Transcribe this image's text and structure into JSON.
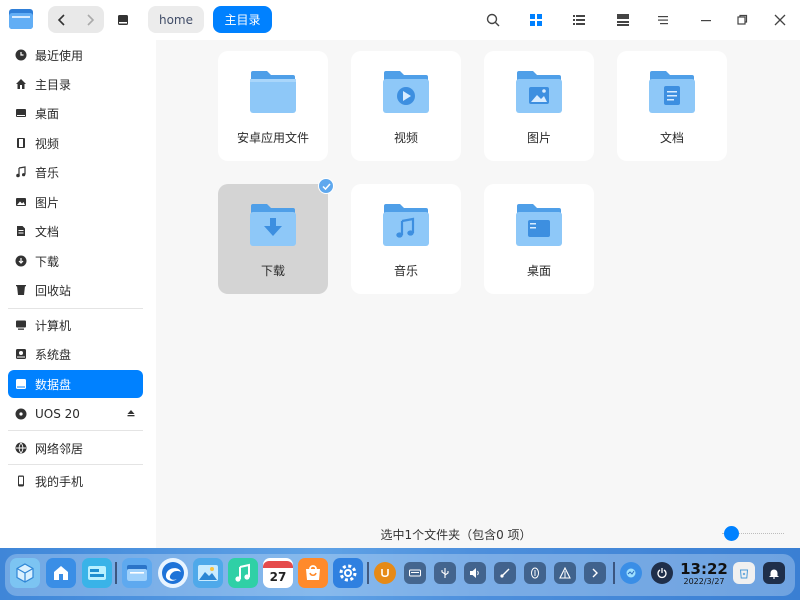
{
  "titlebar": {
    "breadcrumb_home": "home",
    "breadcrumb_current": "主目录"
  },
  "sidebar": {
    "items": [
      {
        "label": "最近使用",
        "icon": "clock-icon"
      },
      {
        "label": "主目录",
        "icon": "home-icon"
      },
      {
        "label": "桌面",
        "icon": "desktop-icon"
      },
      {
        "label": "视频",
        "icon": "film-icon"
      },
      {
        "label": "音乐",
        "icon": "music-icon"
      },
      {
        "label": "图片",
        "icon": "image-icon"
      },
      {
        "label": "文档",
        "icon": "document-icon"
      },
      {
        "label": "下载",
        "icon": "download-icon"
      },
      {
        "label": "回收站",
        "icon": "trash-icon"
      },
      {
        "label": "计算机",
        "icon": "computer-icon"
      },
      {
        "label": "系统盘",
        "icon": "disk-icon"
      },
      {
        "label": "数据盘",
        "icon": "disk-icon",
        "active": true
      },
      {
        "label": "UOS 20",
        "icon": "optical-disc-icon"
      },
      {
        "label": "网络邻居",
        "icon": "network-icon"
      },
      {
        "label": "我的手机",
        "icon": "phone-icon"
      }
    ]
  },
  "files": [
    {
      "label": "安卓应用文件",
      "emblem": "none"
    },
    {
      "label": "视频",
      "emblem": "play"
    },
    {
      "label": "图片",
      "emblem": "image"
    },
    {
      "label": "文档",
      "emblem": "document"
    },
    {
      "label": "下载",
      "emblem": "download",
      "selected": true
    },
    {
      "label": "音乐",
      "emblem": "music"
    },
    {
      "label": "桌面",
      "emblem": "desktop"
    }
  ],
  "status": {
    "text": "选中1个文件夹（包含0 项）"
  },
  "dock": {
    "time": "13:22",
    "date": "2022/3/27",
    "calendar_day": "27"
  },
  "colors": {
    "accent": "#0081ff",
    "folder_light": "#8ec8f8",
    "folder_dark": "#4f9fe8"
  }
}
